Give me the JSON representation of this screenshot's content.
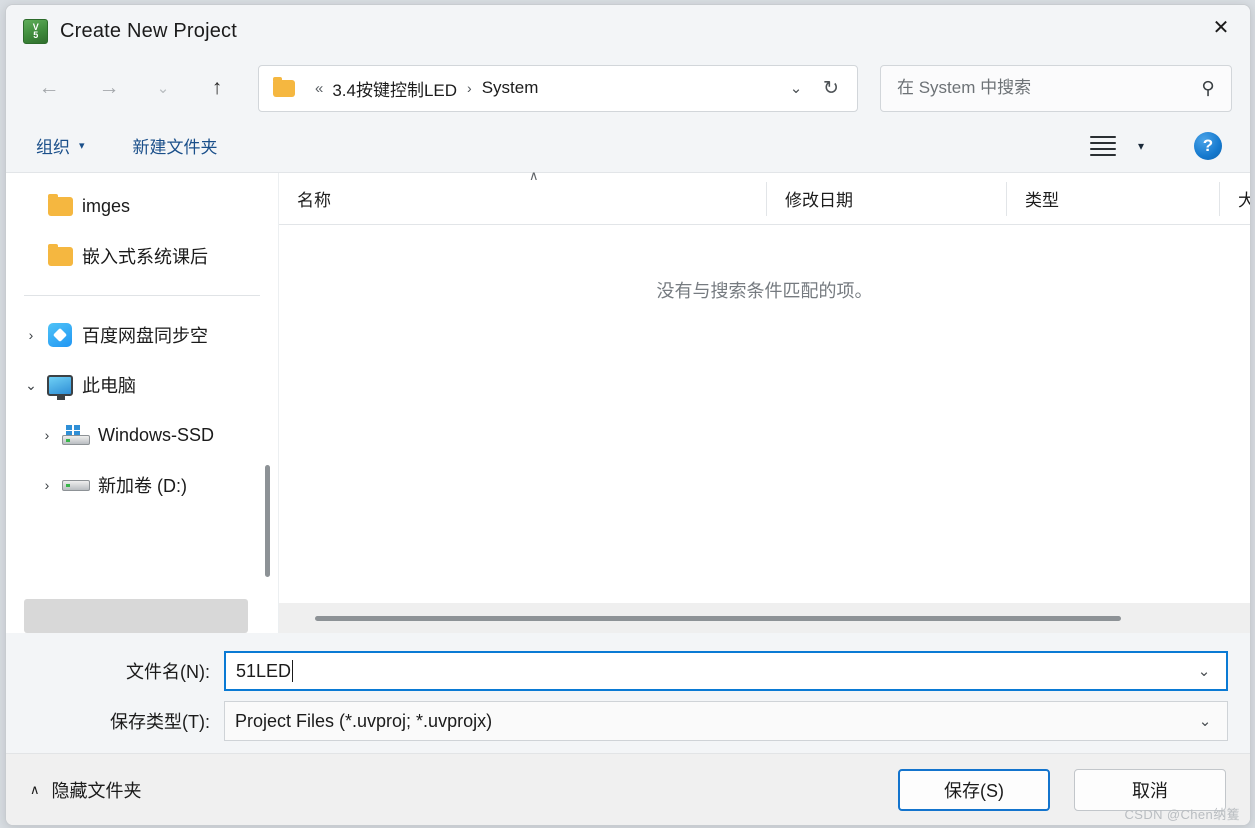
{
  "window": {
    "title": "Create New Project",
    "app_icon": "uvision5-icon",
    "close_label": "✕",
    "accent_color": "#1374cd"
  },
  "nav": {
    "back": "←",
    "forward": "→",
    "recent": "⌄",
    "up": "↑",
    "refresh": "↻",
    "address_dropdown": "⌄"
  },
  "address": {
    "prefix": "«",
    "crumbs": [
      "3.4按键控制LED",
      "System"
    ],
    "separator": "›"
  },
  "search": {
    "placeholder": "在 System 中搜索",
    "value": "",
    "icon": "search-icon"
  },
  "commandbar": {
    "organize": "组织",
    "organize_caret": "▾",
    "new_folder": "新建文件夹",
    "view_caret": "▾",
    "help": "?"
  },
  "sidebar": {
    "items": [
      {
        "label": "imges",
        "icon": "folder-icon",
        "twisty": "",
        "indent": false
      },
      {
        "label": "嵌入式系统课后",
        "icon": "folder-icon",
        "twisty": "",
        "indent": false
      },
      {
        "label": "百度网盘同步空",
        "icon": "baidu-netdisk-icon",
        "twisty": "›",
        "indent": false
      },
      {
        "label": "此电脑",
        "icon": "this-pc-icon",
        "twisty": "⌄",
        "indent": false
      },
      {
        "label": "Windows-SSD",
        "icon": "ssd-drive-icon",
        "twisty": "›",
        "indent": true
      },
      {
        "label": "新加卷 (D:)",
        "icon": "drive-icon",
        "twisty": "›",
        "indent": true
      }
    ]
  },
  "filelist": {
    "columns": [
      "名称",
      "修改日期",
      "类型",
      "大小"
    ],
    "sort_indicator": "∧",
    "rows": [],
    "empty_message": "没有与搜索条件匹配的项。"
  },
  "form": {
    "filename_label": "文件名(N):",
    "filename_value": "51LED",
    "filetype_label": "保存类型(T):",
    "filetype_value": "Project Files (*.uvproj; *.uvprojx)",
    "dropdown_caret": "⌄"
  },
  "footer": {
    "hide_folders_chevron": "∧",
    "hide_folders": "隐藏文件夹",
    "save": "保存(S)",
    "cancel": "取消",
    "watermark": "CSDN @Chen纳籆"
  }
}
